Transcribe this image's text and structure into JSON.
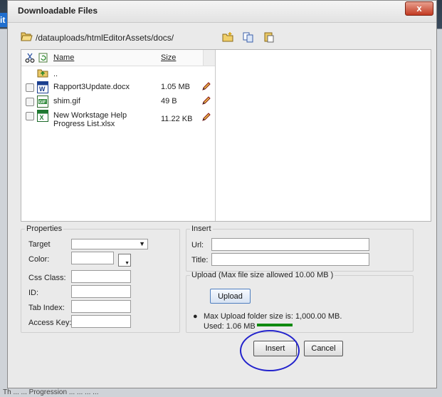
{
  "dialog": {
    "title": "Downloadable Files",
    "close_label": "x"
  },
  "background": {
    "left_glyph": "it",
    "bottom_text": "Th ... ... Progression ... ... ... ..."
  },
  "path": {
    "current": "/datauploads/htmlEditorAssets/docs/"
  },
  "filelist": {
    "header_name": "Name",
    "header_size": "Size",
    "parent_label": "..",
    "files": [
      {
        "name": "Rapport3Update.docx",
        "size": "1.05 MB",
        "icon": "word-doc-icon"
      },
      {
        "name": "shim.gif",
        "size": "49 B",
        "icon": "gif-image-icon"
      },
      {
        "name": "New Workstage Help Progress List.xlsx",
        "size": "11.22 KB",
        "icon": "excel-doc-icon"
      }
    ]
  },
  "properties": {
    "legend": "Properties",
    "target_label": "Target",
    "color_label": "Color:",
    "css_class_label": "Css Class:",
    "id_label": "ID:",
    "tab_index_label": "Tab Index:",
    "access_key_label": "Access Key:"
  },
  "insert": {
    "legend": "Insert",
    "url_label": "Url:",
    "title_label": "Title:"
  },
  "upload": {
    "legend": "Upload (Max file size allowed 10.00 MB )",
    "button": "Upload",
    "max_folder": "Max Upload folder size is: 1,000.00 MB.",
    "used": "Used: 1.06 MB",
    "used_fraction": 0.00106
  },
  "buttons": {
    "insert": "Insert",
    "cancel": "Cancel"
  },
  "colors": {
    "annotation_circle": "#2222cc",
    "used_bar": "#0f8a0f"
  }
}
